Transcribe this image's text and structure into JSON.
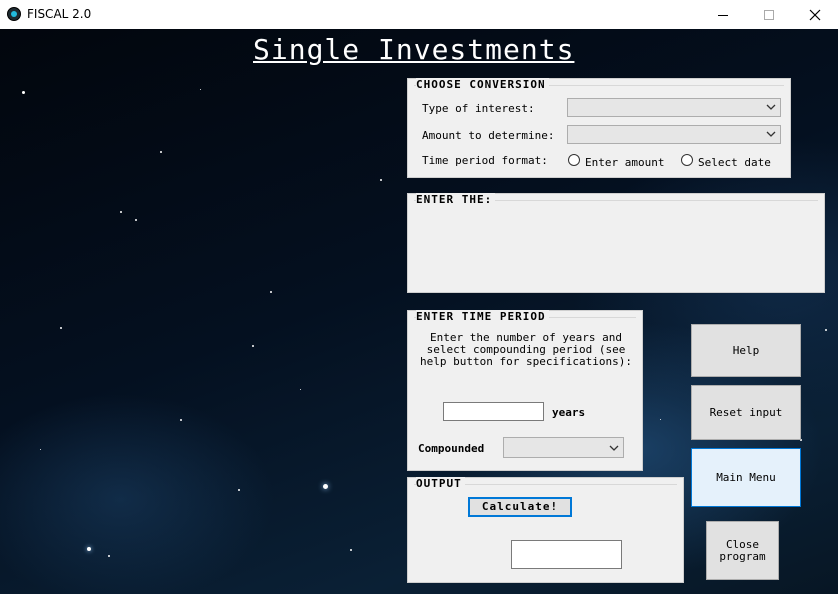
{
  "window": {
    "title": "FISCAL 2.0"
  },
  "heading": "Single Investments",
  "conversion": {
    "title": "CHOOSE CONVERSION",
    "type_label": "Type of interest:",
    "amount_label": "Amount to determine:",
    "period_label": "Time period format:",
    "option_amount": "Enter amount",
    "option_date": "Select date"
  },
  "enter": {
    "title": "ENTER THE:"
  },
  "time_period": {
    "title": "ENTER TIME PERIOD",
    "instructions": "Enter the number of years and select compounding period (see help button for specifications):",
    "years_value": "",
    "years_label": "years",
    "compounded_label": "Compounded"
  },
  "output": {
    "title": "OUTPUT",
    "calculate_label": "Calculate!",
    "result_value": ""
  },
  "buttons": {
    "help": "Help",
    "reset": "Reset input",
    "main_menu": "Main Menu",
    "close": "Close program"
  }
}
